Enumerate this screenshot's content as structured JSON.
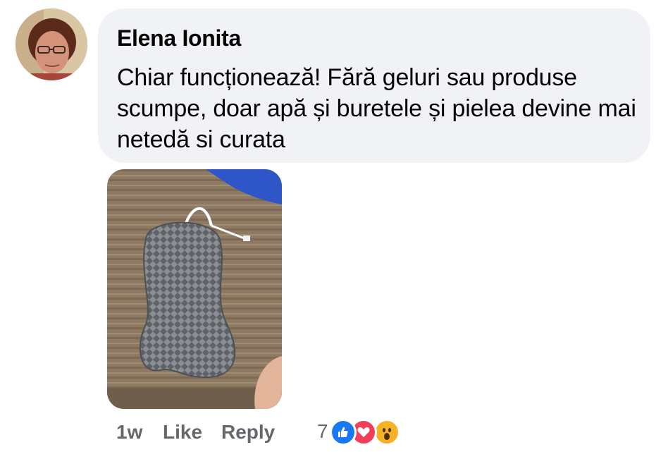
{
  "comment": {
    "author": "Elena Ionita",
    "text": "Chiar funcționează! Fără geluri sau produse scumpe, doar apă și buretele și pielea devine mai netedă si curata",
    "time": "1w",
    "like_label": "Like",
    "reply_label": "Reply",
    "reaction_count": "7",
    "reactions": [
      "like-icon",
      "love-icon",
      "wow-icon"
    ]
  },
  "colors": {
    "bubble": "#f0f2f5",
    "meta_text": "#65676b",
    "like_blue": "#1877f2",
    "love_red": "#f33e58",
    "wow_yellow": "#f7b125"
  }
}
